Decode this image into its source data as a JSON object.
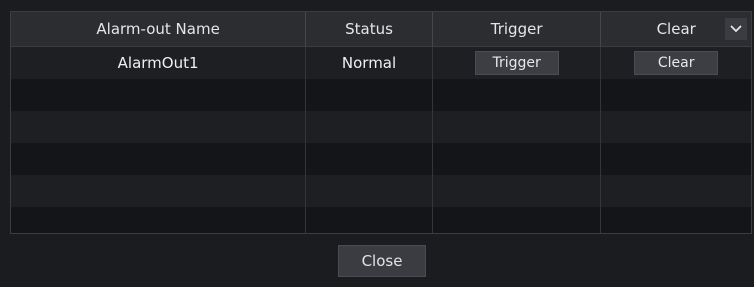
{
  "table": {
    "columns": [
      "Alarm-out Name",
      "Status",
      "Trigger",
      "Clear"
    ],
    "rows": [
      {
        "name": "AlarmOut1",
        "status": "Normal",
        "trigger_label": "Trigger",
        "clear_label": "Clear"
      }
    ],
    "empty_rows": 5
  },
  "header_dropdown_icon": "chevron-down-icon",
  "footer": {
    "close_label": "Close"
  },
  "colors": {
    "background": "#1b1c1f",
    "header_bg": "#2b2d31",
    "row_alt": "#1e1f23",
    "button_bg": "#3c3e43",
    "text": "#e3e3e3"
  }
}
